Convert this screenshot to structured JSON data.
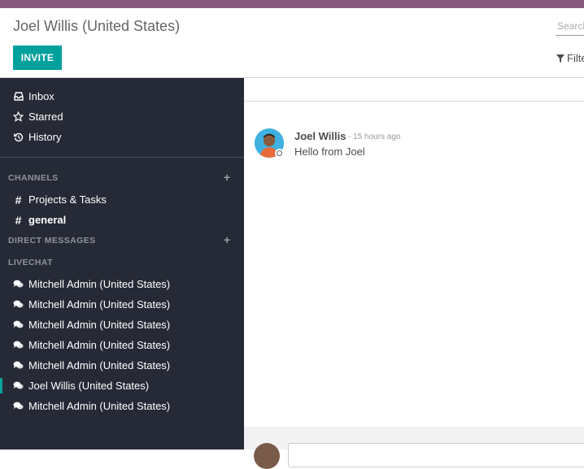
{
  "control_panel": {
    "title": "Joel Willis (United States)",
    "invite_label": "INVITE",
    "search_placeholder": "Search",
    "filters_label": "Filters"
  },
  "sidebar": {
    "mailboxes": [
      {
        "label": "Inbox",
        "icon": "inbox-icon"
      },
      {
        "label": "Starred",
        "icon": "star-icon"
      },
      {
        "label": "History",
        "icon": "history-icon"
      }
    ],
    "channels_header": "CHANNELS",
    "channels": [
      {
        "label": "Projects & Tasks",
        "icon": "hashtag-icon"
      },
      {
        "label": "general",
        "icon": "hashtag-icon",
        "bold": true
      }
    ],
    "direct_messages_header": "DIRECT MESSAGES",
    "livechat_header": "LIVECHAT",
    "livechat": [
      {
        "label": "Mitchell Admin (United States)"
      },
      {
        "label": "Mitchell Admin (United States)"
      },
      {
        "label": "Mitchell Admin (United States)"
      },
      {
        "label": "Mitchell Admin (United States)"
      },
      {
        "label": "Mitchell Admin (United States)"
      },
      {
        "label": "Joel Willis (United States)",
        "active": true
      },
      {
        "label": "Mitchell Admin (United States)"
      }
    ]
  },
  "thread": {
    "messages": [
      {
        "author": "Joel Willis",
        "date": "- 15 hours ago",
        "body": "Hello from Joel"
      }
    ]
  },
  "colors": {
    "brand_bar": "#875a7b",
    "accent": "#00a09d",
    "sidebar_bg": "#262a36"
  }
}
